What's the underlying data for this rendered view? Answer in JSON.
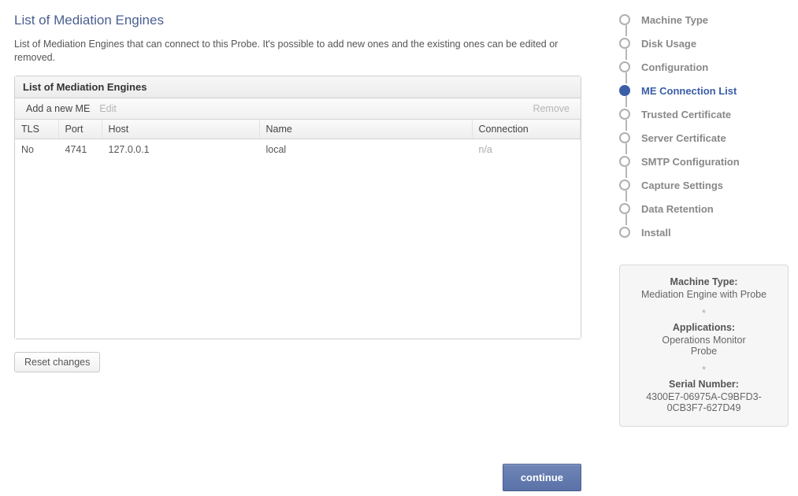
{
  "page": {
    "title": "List of Mediation Engines",
    "description": "List of Mediation Engines that can connect to this Probe. It's possible to add new ones and the existing ones can be edited or removed."
  },
  "panel": {
    "title": "List of Mediation Engines",
    "toolbar": {
      "add": "Add a new ME",
      "edit": "Edit",
      "remove": "Remove"
    },
    "columns": {
      "tls": "TLS",
      "port": "Port",
      "host": "Host",
      "name": "Name",
      "connection": "Connection"
    },
    "rows": [
      {
        "tls": "No",
        "port": "4741",
        "host": "127.0.0.1",
        "name": "local",
        "connection": "n/a"
      }
    ]
  },
  "buttons": {
    "reset": "Reset changes",
    "continue": "continue"
  },
  "stepper": {
    "items": [
      {
        "label": "Machine Type",
        "active": false
      },
      {
        "label": "Disk Usage",
        "active": false
      },
      {
        "label": "Configuration",
        "active": false
      },
      {
        "label": "ME Connection List",
        "active": true
      },
      {
        "label": "Trusted Certificate",
        "active": false
      },
      {
        "label": "Server Certificate",
        "active": false
      },
      {
        "label": "SMTP Configuration",
        "active": false
      },
      {
        "label": "Capture Settings",
        "active": false
      },
      {
        "label": "Data Retention",
        "active": false
      },
      {
        "label": "Install",
        "active": false
      }
    ]
  },
  "info": {
    "machine_type_label": "Machine Type:",
    "machine_type_value": "Mediation Engine with Probe",
    "applications_label": "Applications:",
    "applications_values": [
      "Operations Monitor",
      "Probe"
    ],
    "serial_label": "Serial Number:",
    "serial_value_line1": "4300E7-06975A-C9BFD3-",
    "serial_value_line2": "0CB3F7-627D49"
  }
}
